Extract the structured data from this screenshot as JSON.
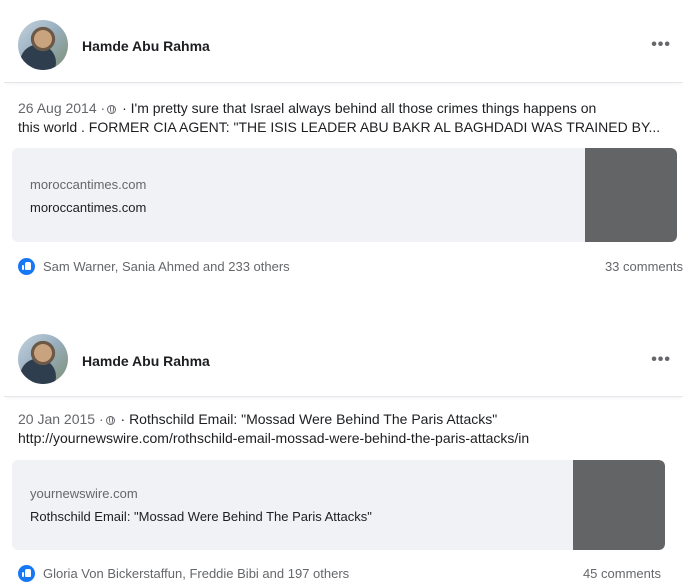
{
  "posts": [
    {
      "author": "Hamde Abu Rahma",
      "more": "•••",
      "date": "26 Aug 2014 ·",
      "text_line1": " · I'm pretty sure that Israel always behind all those crimes things happens on",
      "text_line2": "this world . FORMER CIA AGENT: \"THE ISIS LEADER ABU BAKR AL BAGHDADI WAS TRAINED BY...",
      "link_domain": "moroccantimes.com",
      "link_title": "moroccantimes.com",
      "reactions": "Sam Warner, Sania Ahmed and 233 others",
      "comments": "33 comments"
    },
    {
      "author": "Hamde Abu Rahma",
      "more": "•••",
      "date": "20 Jan 2015 ·",
      "text_line1": " · Rothschild Email: \"Mossad Were Behind The Paris Attacks\"",
      "text_line2": "http://yournewswire.com/rothschild-email-mossad-were-behind-the-paris-attacks/in",
      "link_domain": "yournewswire.com",
      "link_title": "Rothschild Email: \"Mossad Were Behind The Paris Attacks\"",
      "reactions": "Gloria Von Bickerstaffun, Freddie Bibi and 197 others",
      "comments": "45 comments"
    }
  ],
  "icons": {
    "privacy": "globe-icon",
    "reaction": "like-icon",
    "menu": "more-options-icon"
  },
  "colors": {
    "like": "#1877f2",
    "secondary_text": "#65676b",
    "card_bg": "#f0f2f5"
  }
}
